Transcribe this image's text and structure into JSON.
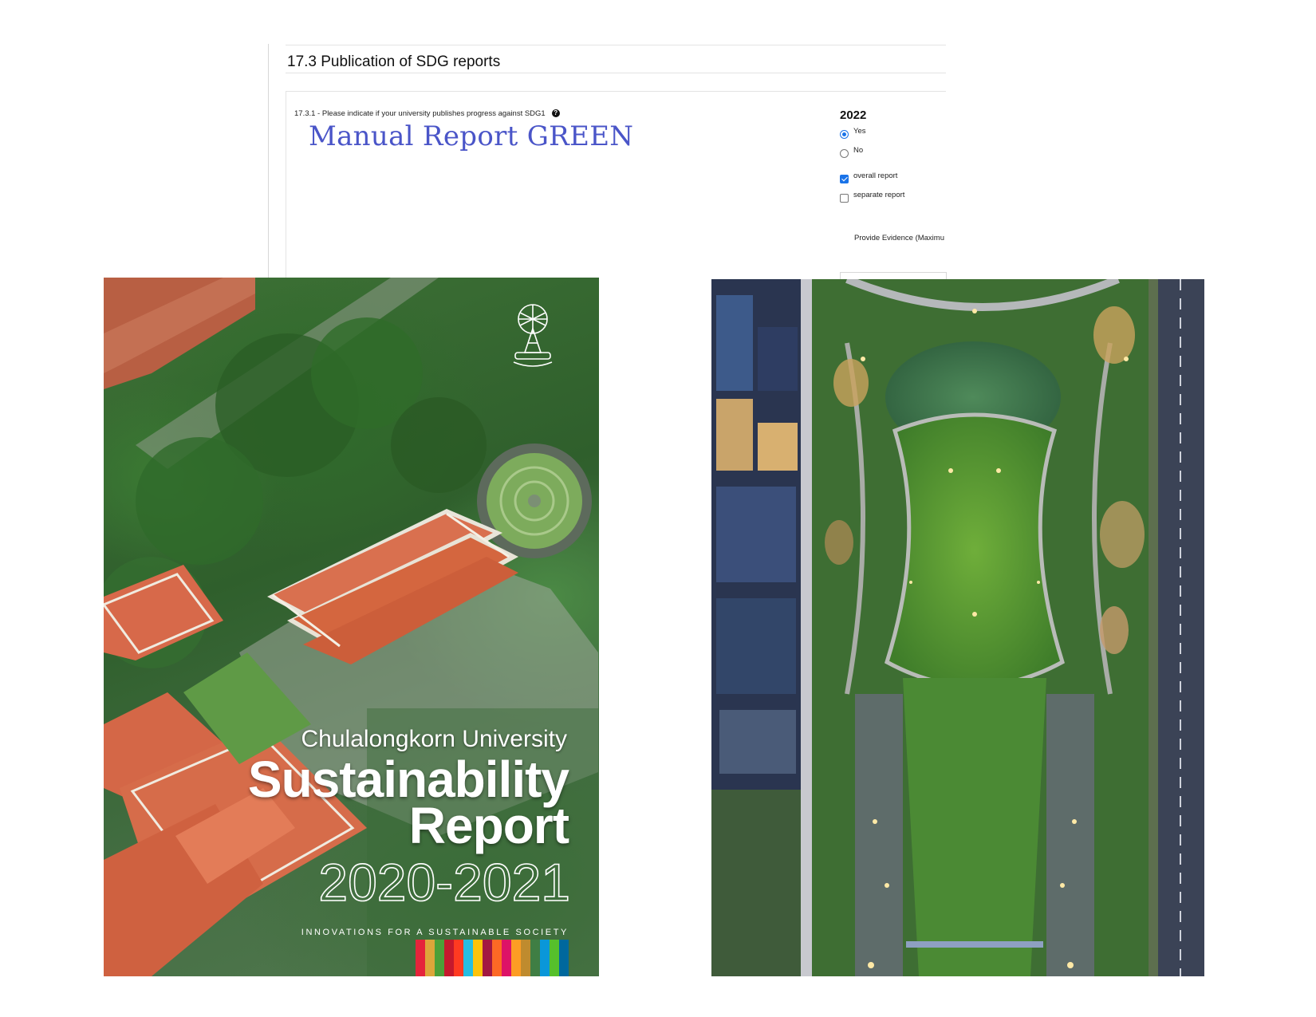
{
  "section": {
    "title": "17.3 Publication of SDG reports"
  },
  "question": {
    "text": "17.3.1 - Please indicate if your university publishes progress against SDG1",
    "help_icon": "question-circle-icon",
    "handwritten_note": "Manual Report GREEN"
  },
  "answer": {
    "year": "2022",
    "options": [
      {
        "label": "Yes",
        "type": "radio",
        "checked": true
      },
      {
        "label": "No",
        "type": "radio",
        "checked": false
      },
      {
        "label": "overall report",
        "type": "checkbox",
        "checked": true
      },
      {
        "label": "separate report",
        "type": "checkbox",
        "checked": false
      }
    ],
    "evidence_label": "Provide Evidence (Maximu"
  },
  "cover": {
    "university": "Chulalongkorn University",
    "title_line1": "Sustainability",
    "title_line2": "Report",
    "years": "2020-2021",
    "tagline": "INNOVATIONS FOR A SUSTAINABLE SOCIETY",
    "sdg_colors": [
      "#e5243b",
      "#dda63a",
      "#4c9f38",
      "#c5192d",
      "#ff3a21",
      "#26bde2",
      "#fcc30b",
      "#a21942",
      "#fd6925",
      "#dd1367",
      "#fd9d24",
      "#bf8b2e",
      "#3f7e44",
      "#0a97d9",
      "#56c02b",
      "#00689d"
    ]
  },
  "colors": {
    "accent_blue": "#1a73e8",
    "handwriting_blue": "#4a55c8"
  }
}
